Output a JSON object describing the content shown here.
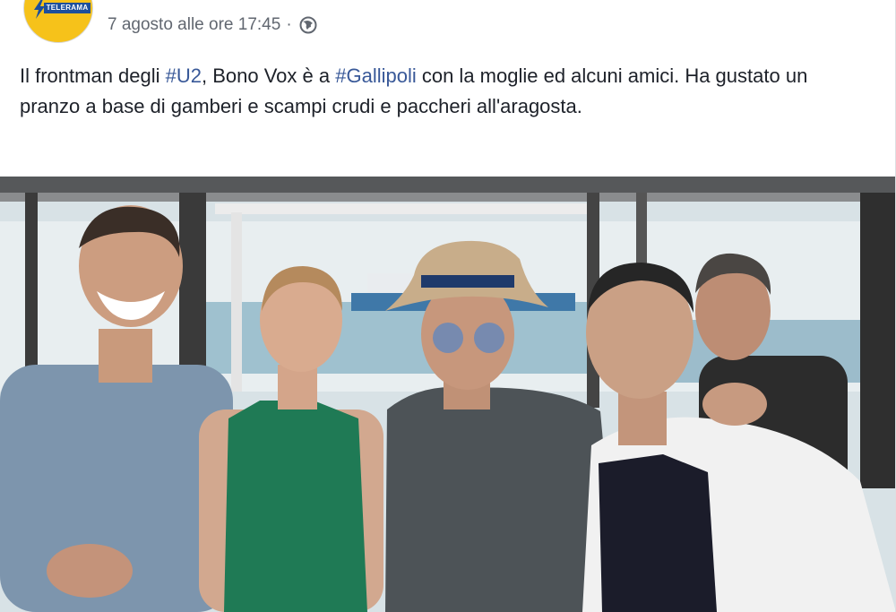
{
  "page": {
    "background": "#e9ebee"
  },
  "post": {
    "page_logo_text": "TELERAMA",
    "timestamp": "7 agosto alle ore 17:45",
    "separator": "·",
    "audience_icon": "globe-icon",
    "text": {
      "part1": "Il frontman degli ",
      "hashtag1": "#U2",
      "part2": ", Bono Vox è a ",
      "hashtag2": "#Gallipoli",
      "part3": " con la moglie ed alcuni amici. Ha gustato un pranzo a base di gamberi e scampi crudi e paccheri all'aragosta."
    },
    "colors": {
      "link": "#385898",
      "text": "#1d2129",
      "meta": "#616770",
      "logo_bg": "#f6c21a",
      "logo_band": "#1d4f9c"
    }
  }
}
